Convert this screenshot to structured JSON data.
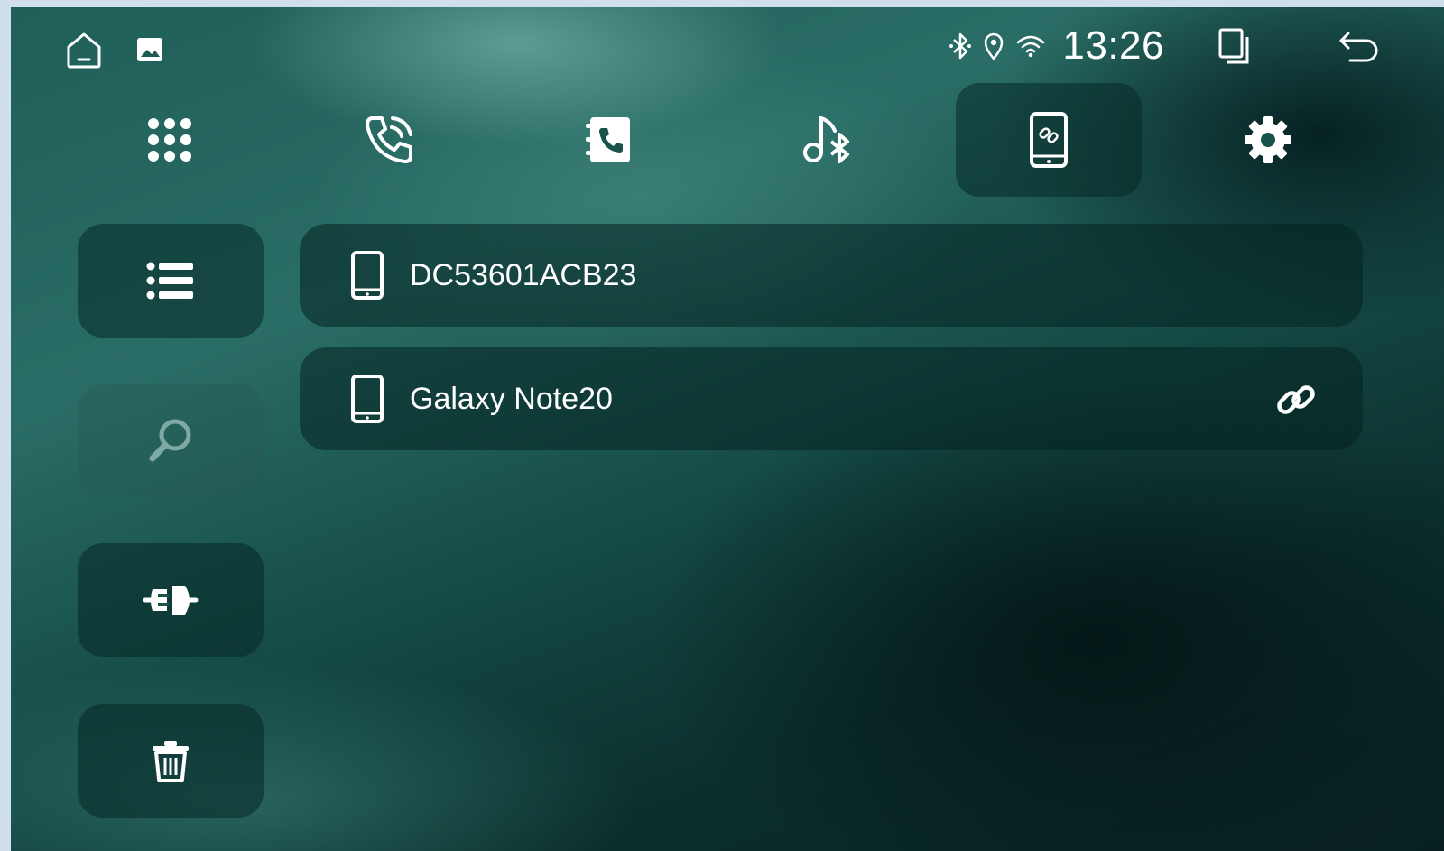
{
  "status_bar": {
    "time": "13:26",
    "left_icons": [
      "home-icon",
      "gallery-icon"
    ],
    "right_icons": [
      "bluetooth-icon",
      "location-icon",
      "wifi-icon"
    ],
    "nav_icons": [
      "recents-icon",
      "back-icon"
    ]
  },
  "tabs": [
    {
      "icon": "dialpad-icon",
      "active": false
    },
    {
      "icon": "call-log-icon",
      "active": false
    },
    {
      "icon": "contacts-icon",
      "active": false
    },
    {
      "icon": "bluetooth-music-icon",
      "active": false
    },
    {
      "icon": "phone-link-icon",
      "active": true
    },
    {
      "icon": "settings-icon",
      "active": false
    }
  ],
  "sidebar": [
    {
      "icon": "list-icon",
      "enabled": true
    },
    {
      "icon": "search-icon",
      "enabled": false
    },
    {
      "icon": "connect-icon",
      "enabled": true
    },
    {
      "icon": "delete-icon",
      "enabled": true
    }
  ],
  "devices": [
    {
      "name": "DC53601ACB23",
      "icon": "phone-icon",
      "connected": false
    },
    {
      "name": "Galaxy Note20",
      "icon": "phone-icon",
      "connected": true,
      "status_icon": "link-icon"
    }
  ],
  "colors": {
    "accent": "#ffffff",
    "background": "#154a45",
    "panel": "#0a2826"
  }
}
